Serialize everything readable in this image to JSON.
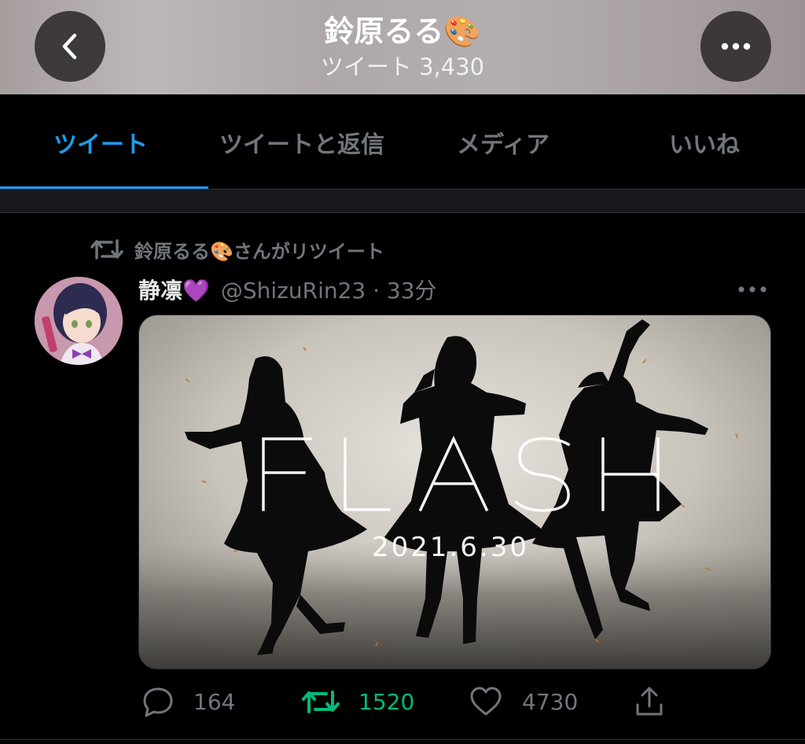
{
  "header": {
    "title": "鈴原るる🎨",
    "tweet_count": "ツイート 3,430"
  },
  "tabs": [
    {
      "label": "ツイート",
      "active": true
    },
    {
      "label": "ツイートと返信",
      "active": false
    },
    {
      "label": "メディア",
      "active": false
    },
    {
      "label": "いいね",
      "active": false
    }
  ],
  "tweet": {
    "retweeted_by": "鈴原るる🎨さんがリツイート",
    "author_name": "静凛💜",
    "handle_time": "@ShizuRin23 · 33分",
    "media": {
      "title_text": "FLASH",
      "date_text": "2021.6.30"
    },
    "actions": {
      "replies": "164",
      "retweets": "1520",
      "likes": "4730"
    }
  },
  "colors": {
    "accent": "#1d9bf0",
    "retweet_green": "#00ba7c",
    "muted": "#71767b"
  },
  "icons": [
    "back-chevron-icon",
    "more-dots-icon",
    "retweet-icon",
    "reply-icon",
    "heart-icon",
    "share-icon"
  ]
}
